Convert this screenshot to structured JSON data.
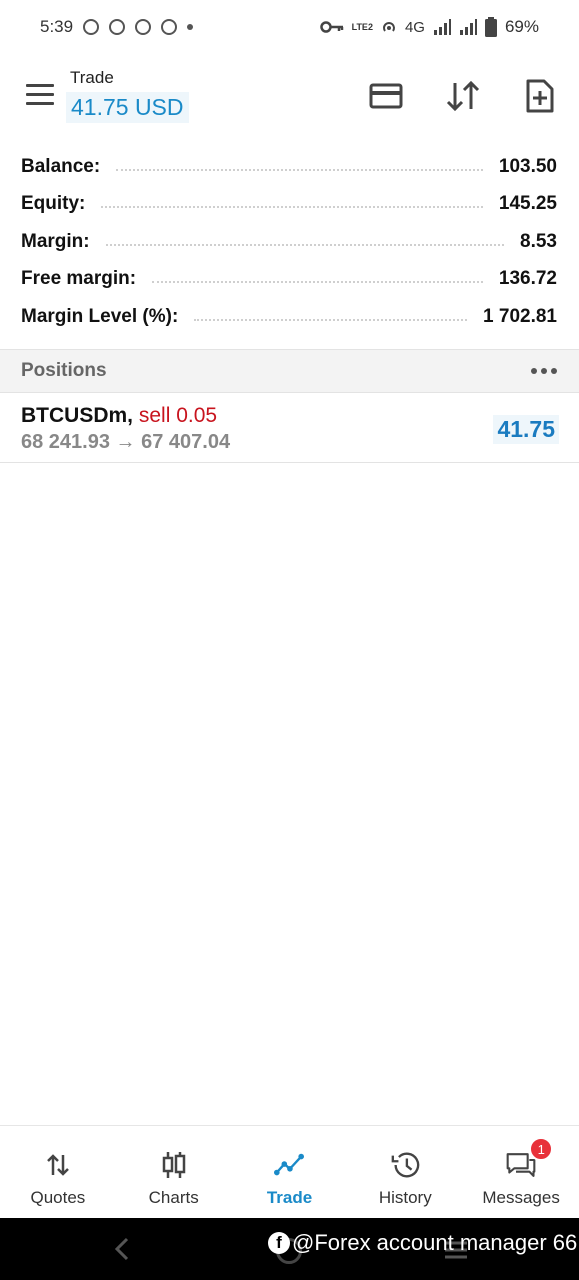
{
  "status_bar": {
    "time": "5:39",
    "network": "4G",
    "volte": "LTE2",
    "battery": "69%"
  },
  "header": {
    "title": "Trade",
    "value": "41.75 USD",
    "icons": [
      "menu-icon",
      "card-icon",
      "sort-icon",
      "new-order-icon"
    ]
  },
  "summary": [
    {
      "label": "Balance:",
      "value": "103.50"
    },
    {
      "label": "Equity:",
      "value": "145.25"
    },
    {
      "label": "Margin:",
      "value": "8.53"
    },
    {
      "label": "Free margin:",
      "value": "136.72"
    },
    {
      "label": "Margin Level (%):",
      "value": "1 702.81"
    }
  ],
  "positions": {
    "title": "Positions",
    "items": [
      {
        "symbol": "BTCUSDm,",
        "side": "sell 0.05",
        "prices": "68 241.93 → 67 407.04",
        "profit": "41.75"
      }
    ]
  },
  "bottom_nav": [
    {
      "label": "Quotes",
      "icon": "quotes-icon",
      "active": false
    },
    {
      "label": "Charts",
      "icon": "charts-icon",
      "active": false
    },
    {
      "label": "Trade",
      "icon": "trade-icon",
      "active": true
    },
    {
      "label": "History",
      "icon": "history-icon",
      "active": false
    },
    {
      "label": "Messages",
      "icon": "messages-icon",
      "active": false,
      "badge": "1"
    }
  ],
  "watermark": {
    "fb_letter": "f",
    "text": "@Forex account manager 66"
  },
  "colors": {
    "accent": "#1a8ac8",
    "sell": "#c8141e",
    "profit": "#1a7bc0",
    "badge": "#e8313a"
  }
}
